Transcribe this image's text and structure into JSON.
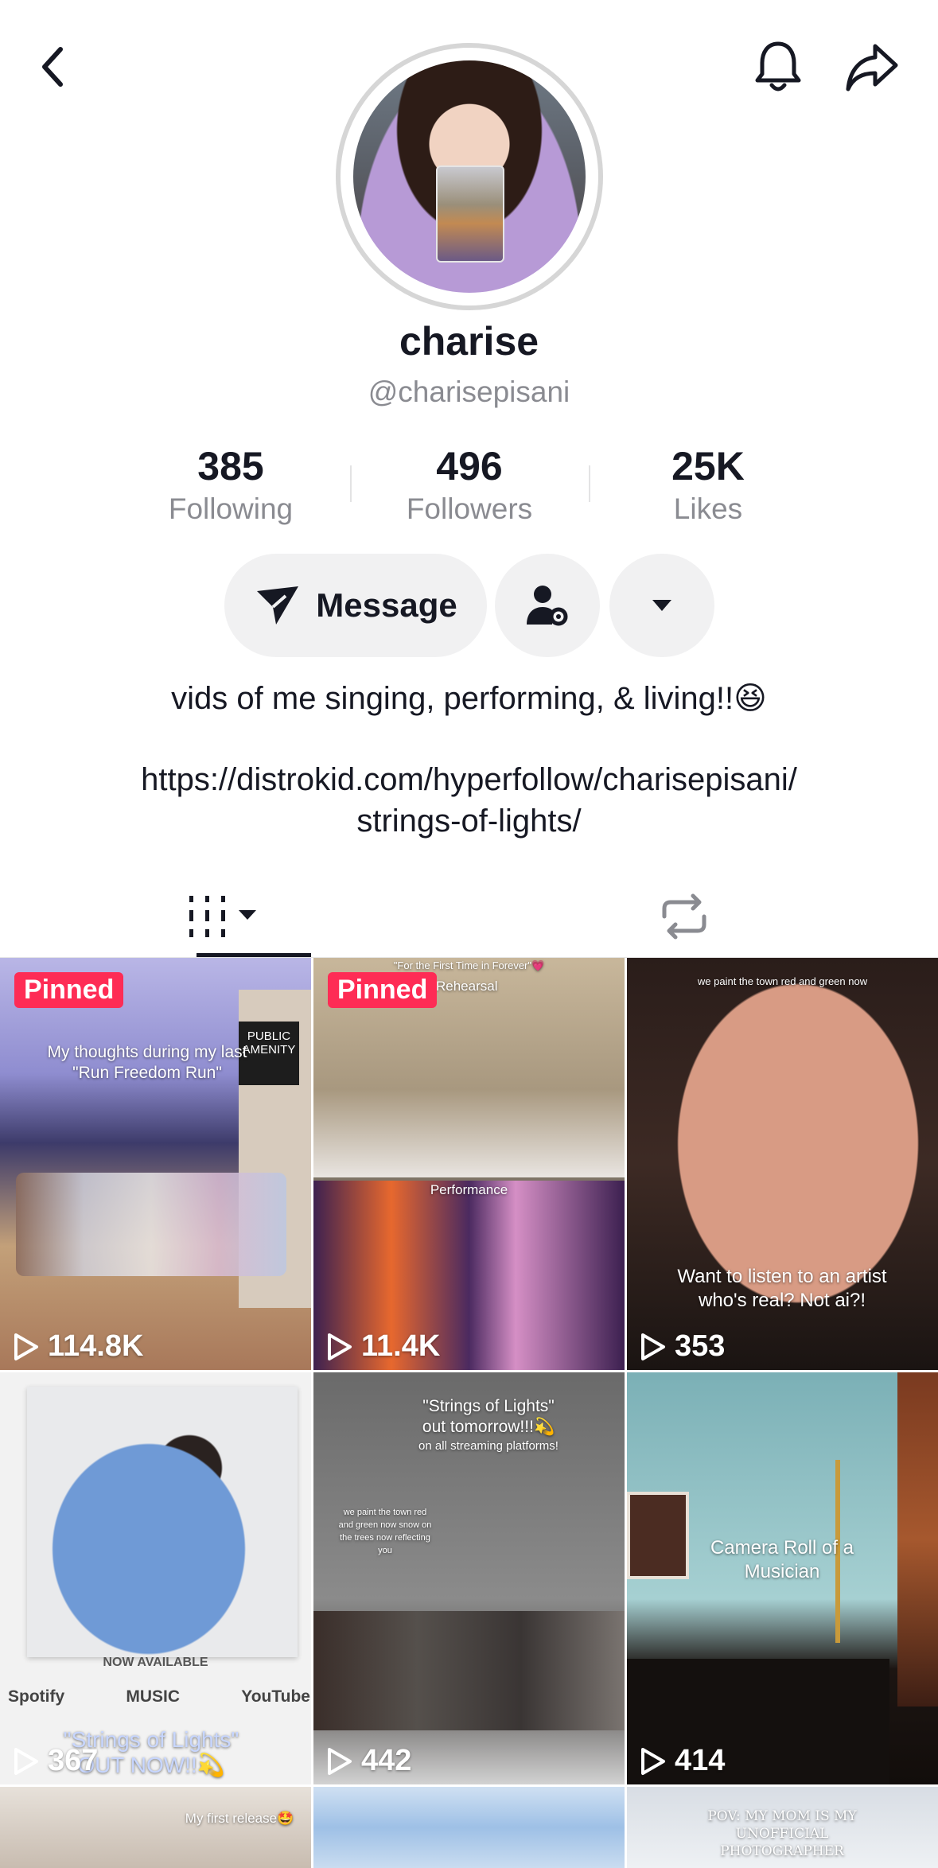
{
  "profile": {
    "display_name": "charise",
    "username": "@charisepisani",
    "bio": "vids of me singing, performing, & living!!😆",
    "link_line1": "https://distrokid.com/hyperfollow/charisepisani/",
    "link_line2": "strings-of-lights/"
  },
  "stats": [
    {
      "value": "385",
      "label": "Following"
    },
    {
      "value": "496",
      "label": "Followers"
    },
    {
      "value": "25K",
      "label": "Likes"
    }
  ],
  "actions": {
    "message_label": "Message"
  },
  "videos": [
    {
      "pinned": "Pinned",
      "views": "114.8K",
      "caption": "My thoughts during my last \"Run Freedom Run\"",
      "sign": "PUBLIC AMENITY"
    },
    {
      "pinned": "Pinned",
      "views": "11.4K",
      "top_caption": "\"For the First Time in Forever\"💗",
      "label_top": "Rehearsal",
      "label_bottom": "Performance"
    },
    {
      "views": "353",
      "top_caption": "we paint the town red and green now",
      "caption": "Want to listen to an artist who's real? Not ai?!"
    },
    {
      "views": "367",
      "now_available": "NOW AVAILABLE",
      "spotify": "Spotify",
      "music": "MUSIC",
      "youtube": "YouTube",
      "caption": "\"Strings of Lights\" OUT NOW!!💫"
    },
    {
      "views": "442",
      "caption": "\"Strings of Lights\" out tomorrow!!!💫",
      "caption_small": "on all streaming platforms!",
      "side_caption": "we paint the town red and green now snow on the trees now reflecting you"
    },
    {
      "views": "414",
      "caption": "Camera Roll of a Musician"
    },
    {
      "caption": "My first release🤩"
    },
    {},
    {
      "caption": "POV: MY MOM IS MY UNOFFICIAL PHOTOGRAPHER"
    }
  ]
}
